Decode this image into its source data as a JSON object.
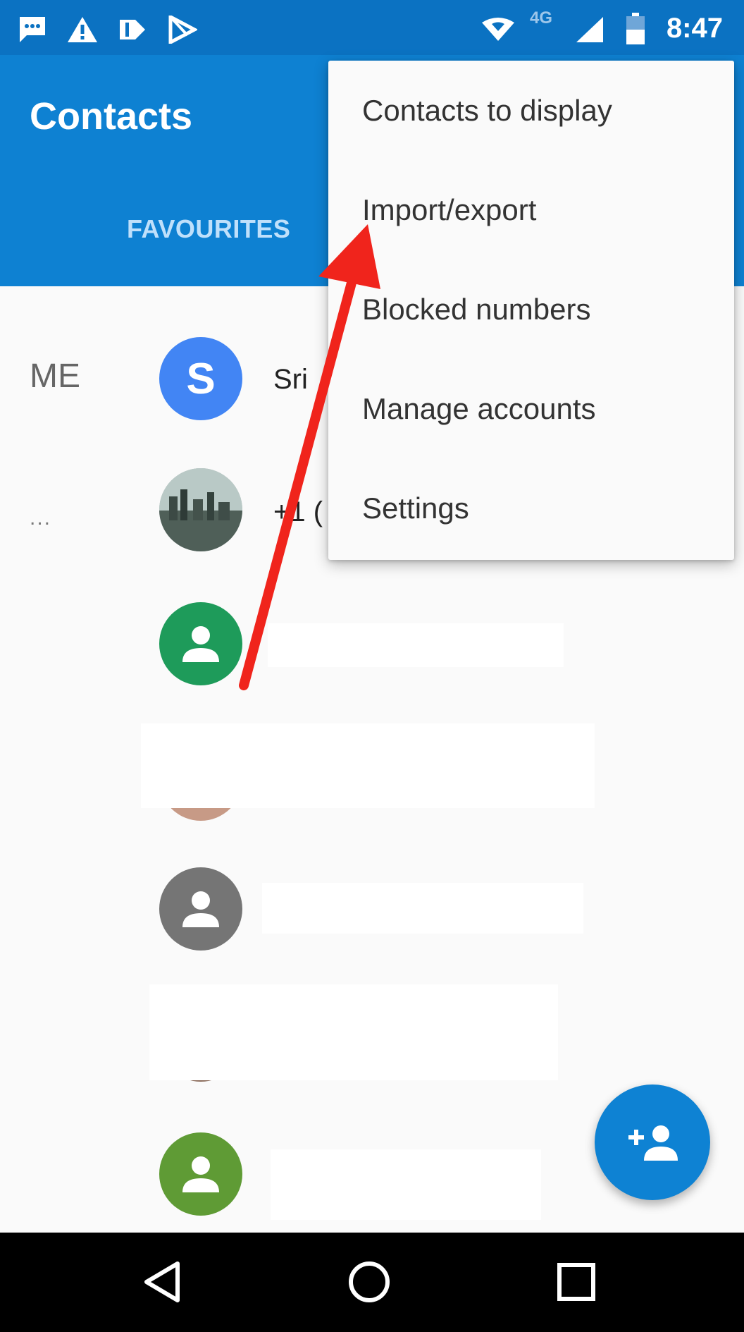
{
  "status_bar": {
    "time": "8:47",
    "network": "4G",
    "icons": [
      "message-icon",
      "warning-icon",
      "tag-icon",
      "play-store-icon",
      "wifi-icon",
      "cellular-signal-icon",
      "battery-icon"
    ]
  },
  "app_bar": {
    "title": "Contacts",
    "tab_favourites": "FAVOURITES"
  },
  "list": {
    "section_me": "ME",
    "section_more": "...",
    "contacts": [
      {
        "avatar_letter": "S",
        "name": "Sri",
        "color": "#4285f4"
      },
      {
        "avatar_type": "photo",
        "name": "+1 (",
        "color": "#6f7f79"
      },
      {
        "avatar_type": "person-icon",
        "color": "#1e9b5a"
      },
      {
        "avatar_type": "person-icon",
        "color": "#757575"
      },
      {
        "avatar_type": "person-icon",
        "color": "#5f9b35"
      }
    ]
  },
  "overflow_menu": {
    "items": [
      "Contacts to display",
      "Import/export",
      "Blocked numbers",
      "Manage accounts",
      "Settings"
    ]
  },
  "fab": {
    "icon": "add-person-icon",
    "color": "#0e82d3"
  },
  "nav_bar": {
    "buttons": [
      "back-icon",
      "home-icon",
      "recents-icon"
    ]
  },
  "annotation": {
    "arrow_color": "#f0241c",
    "points_to": "Import/export"
  }
}
